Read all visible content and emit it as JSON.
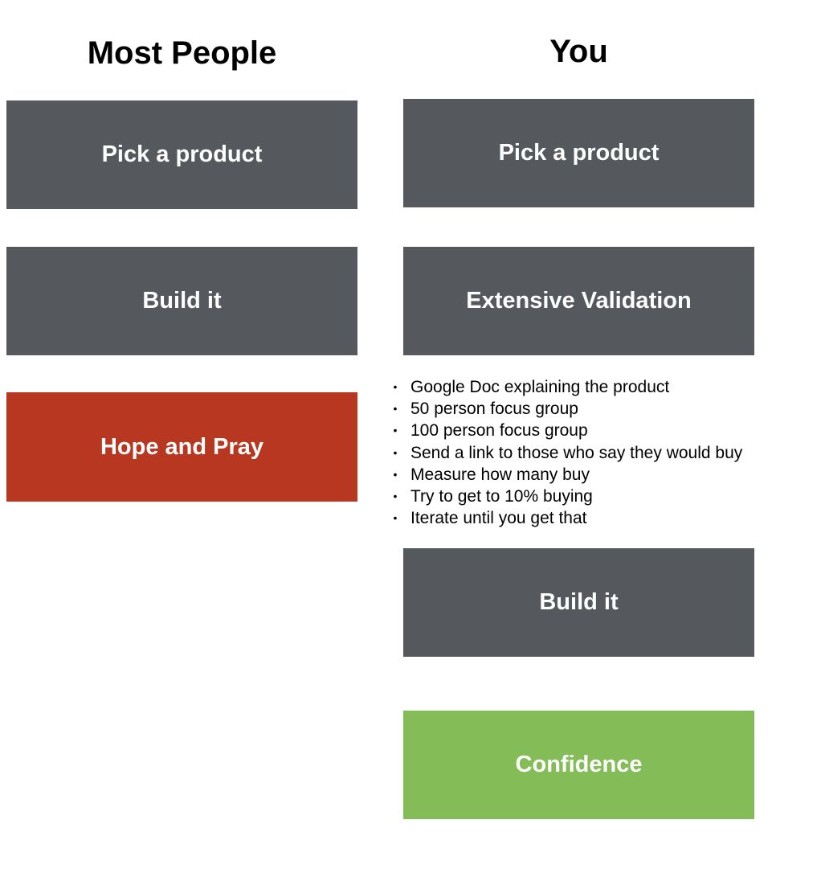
{
  "headings": {
    "left": "Most People",
    "right": "You"
  },
  "most_people": {
    "steps": [
      {
        "label": "Pick a product",
        "color": "#55585c"
      },
      {
        "label": "Build it",
        "color": "#55585c"
      },
      {
        "label": "Hope and Pray",
        "color": "#b83720"
      }
    ]
  },
  "you": {
    "steps": [
      {
        "label": "Pick a product",
        "color": "#55585c"
      },
      {
        "label": "Extensive Validation",
        "color": "#55585c"
      },
      {
        "label": "Build it",
        "color": "#55585c"
      },
      {
        "label": "Confidence",
        "color": "#84bd58"
      }
    ],
    "bullet_glyph": "•",
    "validation_bullets": [
      "Google Doc explaining the product",
      "50 person focus group",
      "100 person focus group",
      "Send a link to those who say they would buy",
      "Measure how many buy",
      "Try to get to 10% buying",
      "Iterate until you get that"
    ]
  }
}
